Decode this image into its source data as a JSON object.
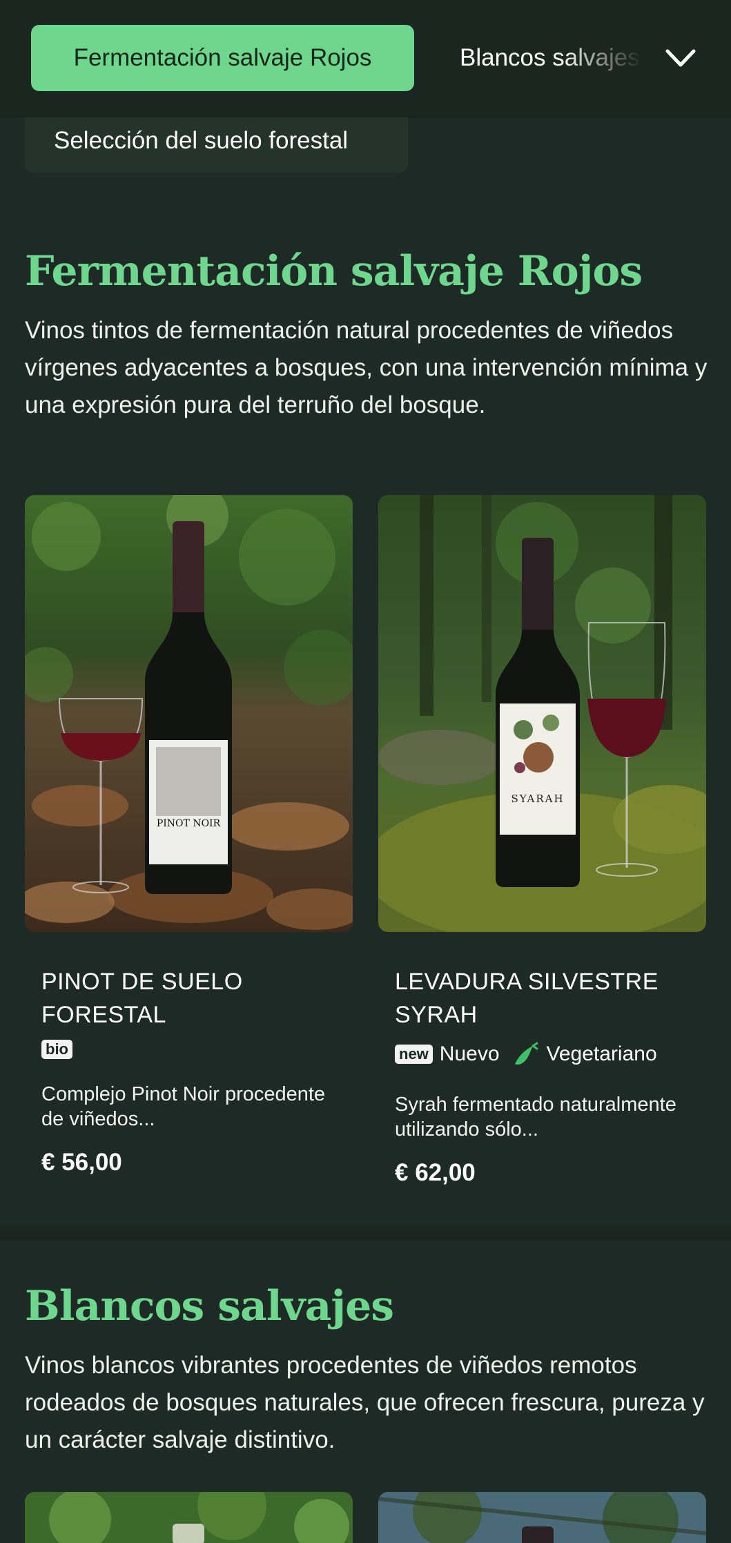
{
  "nav": {
    "active_tab": "Fermentación salvaje Rojos",
    "next_tab": "Blancos salvajes",
    "subnav_item": "Selección del suelo forestal"
  },
  "colors": {
    "accent": "#6fd68e",
    "background": "#1e2a25",
    "topbar": "#1b2621"
  },
  "sections": [
    {
      "title": "Fermentación salvaje Rojos",
      "description": "Vinos tintos de fermentación natural procedentes de viñedos vírgenes adyacentes a bosques, con una intervención mínima y una expresión pura del terruño del bosque.",
      "products": [
        {
          "name": "PINOT DE SUELO FORESTAL",
          "badges": [
            "bio"
          ],
          "description": "Complejo Pinot Noir procedente de viñedos...",
          "price": "€ 56,00",
          "label_text": "PINOT NOIR"
        },
        {
          "name": "LEVADURA SILVESTRE SYRAH",
          "badge_new": "new",
          "tag_new": "Nuevo",
          "tag_veg": "Vegetariano",
          "description": "Syrah fermentado naturalmente utilizando sólo...",
          "price": "€ 62,00",
          "label_text": "SYARAH"
        }
      ]
    },
    {
      "title": "Blancos salvajes",
      "description": "Vinos blancos vibrantes procedentes de viñedos remotos rodeados de bosques naturales, que ofrecen frescura, pureza y un carácter salvaje distintivo."
    }
  ],
  "icons": {
    "chevron": "chevron-down-icon",
    "vegetarian": "leaf-icon"
  }
}
